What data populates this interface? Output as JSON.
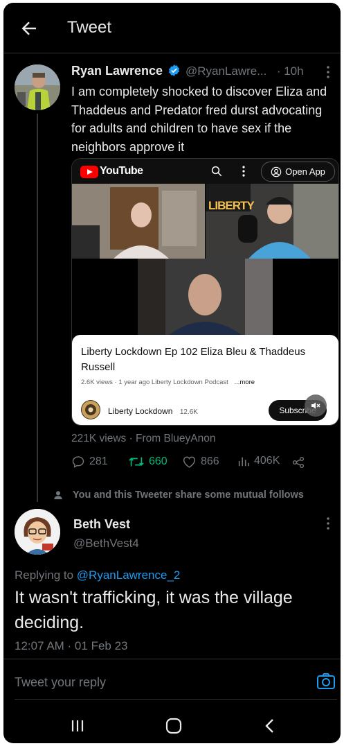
{
  "header": {
    "title": "Tweet"
  },
  "tweet": {
    "author_name": "Ryan Lawrence",
    "handle": "@RyanLawre...",
    "time": "· 10h",
    "text": "I am completely shocked to discover Eliza and Thaddeus and Predator fred durst advocating for adults and children to have sex if the neighbors approve it",
    "video": {
      "brand": "YouTube",
      "open_app": "Open App",
      "title": "Liberty Lockdown Ep 102 Eliza Bleu & Thaddeus Russell",
      "meta": "2.6K views · 1 year ago  Liberty Lockdown Podcast",
      "more": "...more",
      "channel": "Liberty Lockdown",
      "subs": "12.6K",
      "subscribe": "Subscribe",
      "banner": "LIBERTY"
    },
    "views_line": "221K views · From BlueyAnon",
    "stats": {
      "replies": "281",
      "retweets": "660",
      "likes": "866",
      "views": "406K"
    }
  },
  "mutual_follows": "You and this Tweeter share some mutual follows",
  "reply": {
    "author_name": "Beth Vest",
    "handle": "@BethVest4",
    "replying_prefix": "Replying to",
    "replying_to": "@RyanLawrence_2",
    "text": "It wasn't trafficking, it was the village deciding.",
    "timestamp": "12:07 AM · 01 Feb 23"
  },
  "composer": {
    "placeholder": "Tweet your reply"
  },
  "colors": {
    "accent": "#1d9bf0",
    "retweet": "#00ba7c",
    "background": "#000000"
  }
}
